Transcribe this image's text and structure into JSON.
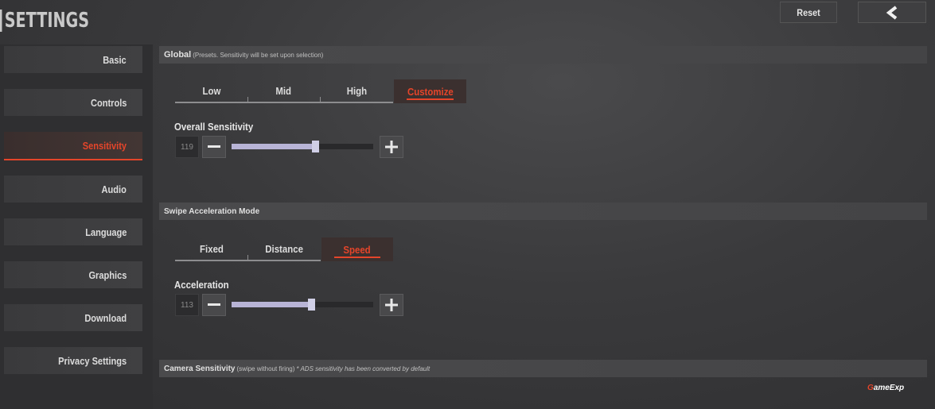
{
  "header": {
    "title": "SETTINGS",
    "reset_label": "Reset",
    "back_icon": "chevron-left-icon"
  },
  "sidebar": {
    "items": [
      {
        "label": "Basic",
        "active": false
      },
      {
        "label": "Controls",
        "active": false
      },
      {
        "label": "Sensitivity",
        "active": true
      },
      {
        "label": "Audio",
        "active": false
      },
      {
        "label": "Language",
        "active": false
      },
      {
        "label": "Graphics",
        "active": false
      },
      {
        "label": "Download",
        "active": false
      },
      {
        "label": "Privacy Settings",
        "active": false
      }
    ]
  },
  "global": {
    "title": "Global",
    "note": "(Presets. Sensitivity will be set upon selection)",
    "presets": [
      "Low",
      "Mid",
      "High",
      "Customize"
    ],
    "selected": "Customize",
    "overall": {
      "label": "Overall Sensitivity",
      "value": "119",
      "fraction": 0.59
    }
  },
  "swipe": {
    "title": "Swipe Acceleration Mode",
    "modes": [
      "Fixed",
      "Distance",
      "Speed"
    ],
    "selected": "Speed",
    "acceleration": {
      "label": "Acceleration",
      "value": "113",
      "fraction": 0.56
    }
  },
  "camera": {
    "title": "Camera Sensitivity",
    "note": "(swipe without firing)",
    "note2": "* ADS sensitivity has been converted by default"
  },
  "watermark": {
    "brand_first": "G",
    "brand_rest": "ameExp"
  },
  "colors": {
    "accent": "#e5452a",
    "slider": "#b8b4d6",
    "background": "#3a3a3c"
  }
}
